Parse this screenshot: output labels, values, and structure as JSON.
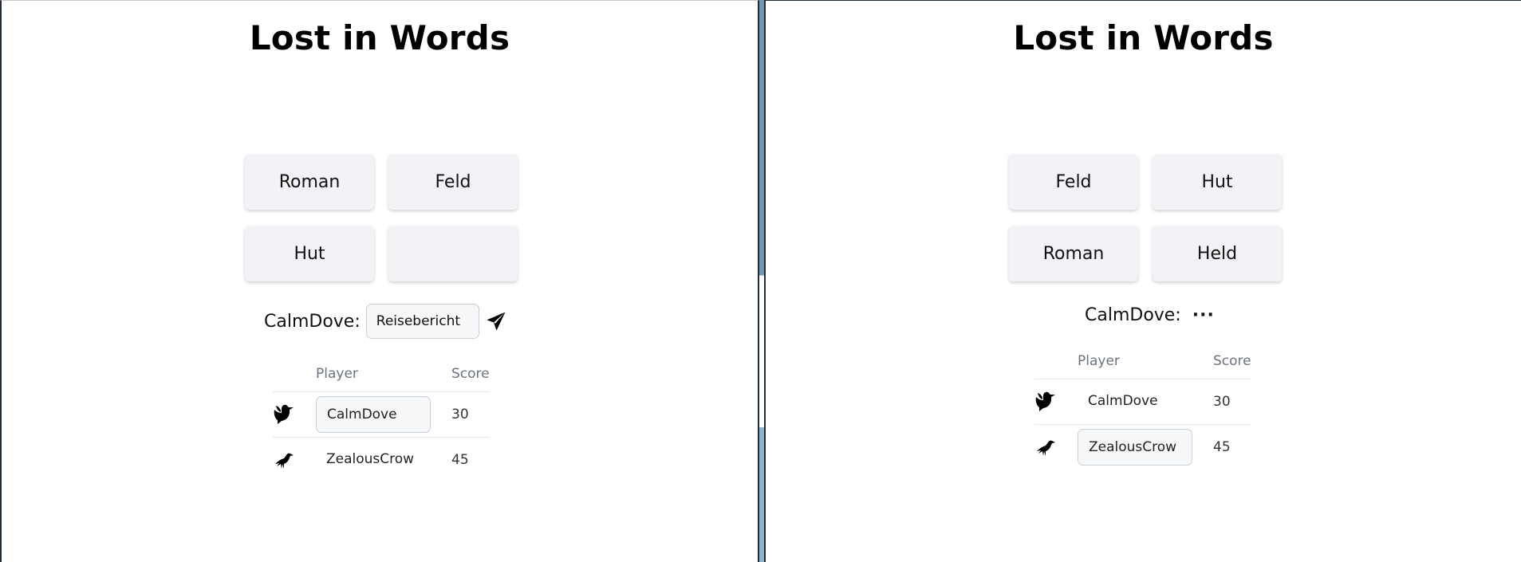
{
  "left": {
    "title": "Lost in Words",
    "tiles": [
      "Roman",
      "Feld",
      "Hut",
      ""
    ],
    "chat": {
      "name": "CalmDove:",
      "input_value": "Reisebericht"
    },
    "scoreboard": {
      "headers": {
        "player": "Player",
        "score": "Score"
      },
      "rows": [
        {
          "player": "CalmDove",
          "score": "30",
          "icon": "dove-icon"
        },
        {
          "player": "ZealousCrow",
          "score": "45",
          "icon": "crow-icon"
        }
      ]
    }
  },
  "right": {
    "title": "Lost in Words",
    "tiles": [
      "Feld",
      "Hut",
      "Roman",
      "Held"
    ],
    "chat": {
      "name": "CalmDove:",
      "status": "···"
    },
    "scoreboard": {
      "headers": {
        "player": "Player",
        "score": "Score"
      },
      "rows": [
        {
          "player": "CalmDove",
          "score": "30",
          "icon": "dove-icon"
        },
        {
          "player": "ZealousCrow",
          "score": "45",
          "icon": "crow-icon"
        }
      ]
    }
  },
  "colors": {
    "tile_bg": "#f1f3f7",
    "frame": "#1f2b36",
    "backdrop": "#7ea6c0"
  }
}
